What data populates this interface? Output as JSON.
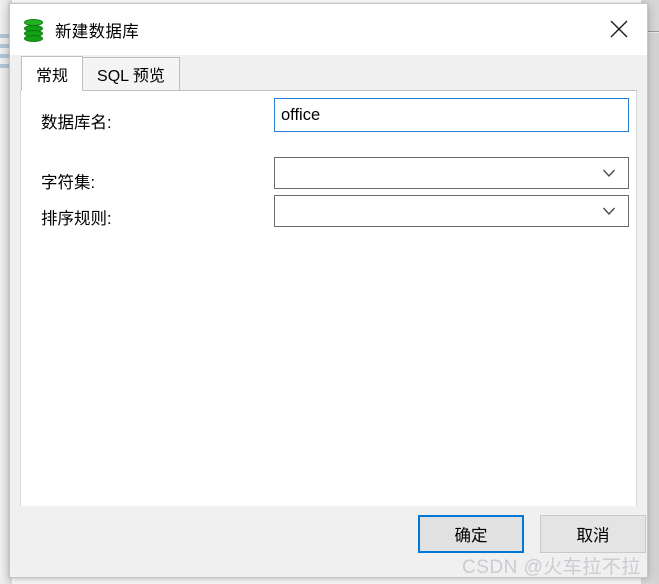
{
  "window": {
    "title": "新建数据库",
    "icon": "database-icon",
    "close_label": "✕",
    "accent_color": "#0078d7",
    "icon_color": "#14a014"
  },
  "tabs": [
    {
      "label": "常规",
      "active": true
    },
    {
      "label": "SQL 预览",
      "active": false
    }
  ],
  "form": {
    "database_name": {
      "label": "数据库名:",
      "value": "office",
      "placeholder": ""
    },
    "charset": {
      "label": "字符集:",
      "value": "",
      "options": []
    },
    "collation": {
      "label": "排序规则:",
      "value": "",
      "options": []
    }
  },
  "footer": {
    "ok_label": "确定",
    "cancel_label": "取消"
  },
  "watermark": {
    "text": "CSDN @火车拉不拉"
  }
}
